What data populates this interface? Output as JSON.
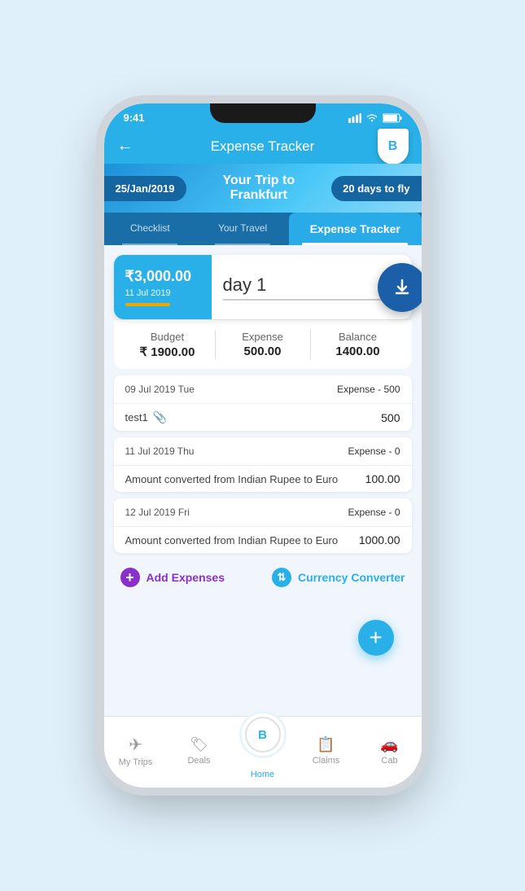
{
  "status_bar": {
    "time": "9:41",
    "signal": "●●●",
    "wifi": "wifi",
    "battery": "battery"
  },
  "header": {
    "back_label": "←",
    "title": "Expense Tracker",
    "logo_letter": "B"
  },
  "trip_banner": {
    "date": "25/Jan/2019",
    "trip_name": "Your Trip to Frankfurt",
    "days_to_fly": "20 days to fly"
  },
  "tabs": {
    "tab1_label": "Checklist",
    "tab2_label": "Your Travel",
    "tab3_label": "Expense Tracker"
  },
  "day_card": {
    "currency_symbol": "₹",
    "amount": "3,000.00",
    "date": "11 Jul 2019",
    "day_label": "day 1"
  },
  "budget_summary": {
    "budget_label": "Budget",
    "budget_value": "₹ 1900.00",
    "expense_label": "Expense",
    "expense_value": "500.00",
    "balance_label": "Balance",
    "balance_value": "1400.00"
  },
  "expense_entries": [
    {
      "date": "09 Jul 2019 Tue",
      "type": "Expense - 500",
      "item_name": "test1",
      "has_attachment": true,
      "amount": "500"
    },
    {
      "date": "11 Jul 2019 Thu",
      "type": "Expense - 0",
      "item_name": "Amount converted from Indian Rupee to Euro",
      "has_attachment": false,
      "amount": "100.00"
    },
    {
      "date": "12 Jul 2019 Fri",
      "type": "Expense - 0",
      "item_name": "Amount converted from Indian Rupee to Euro",
      "has_attachment": false,
      "amount": "1000.00"
    }
  ],
  "actions": {
    "add_expense_label": "Add Expenses",
    "currency_converter_label": "Currency Converter"
  },
  "bottom_nav": {
    "items": [
      {
        "label": "My Trips",
        "icon": "✈"
      },
      {
        "label": "Deals",
        "icon": "🏷"
      },
      {
        "label": "Home",
        "icon": "B",
        "is_home": true
      },
      {
        "label": "Claims",
        "icon": "📋"
      },
      {
        "label": "Cab",
        "icon": "🚗"
      }
    ]
  }
}
